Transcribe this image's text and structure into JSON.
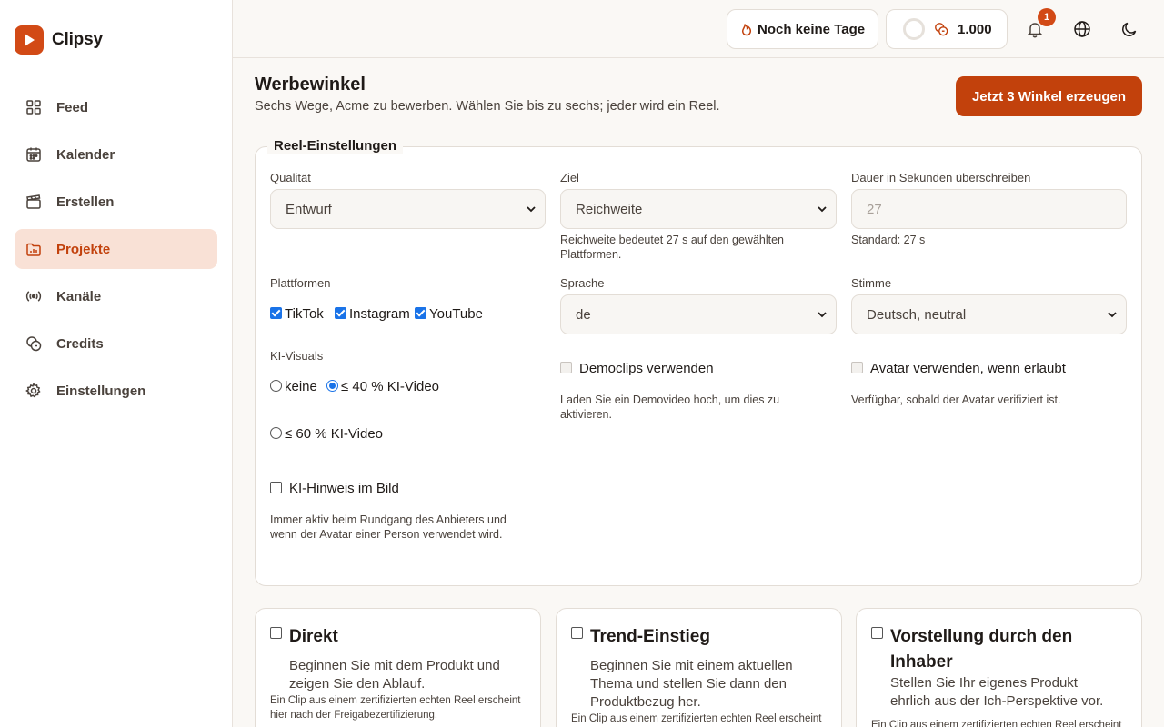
{
  "app": {
    "name": "Clipsy"
  },
  "colors": {
    "accent": "#c2410c",
    "brand": "#d24a16",
    "active_bg": "#f9e1d6",
    "checkbox": "#1a73e8"
  },
  "sidebar": {
    "items": [
      {
        "label": "Feed",
        "icon": "grid-icon"
      },
      {
        "label": "Kalender",
        "icon": "calendar-icon"
      },
      {
        "label": "Erstellen",
        "icon": "clapperboard-icon"
      },
      {
        "label": "Projekte",
        "icon": "folder-chart-icon",
        "active": true
      },
      {
        "label": "Kanäle",
        "icon": "broadcast-icon"
      },
      {
        "label": "Credits",
        "icon": "coins-icon"
      },
      {
        "label": "Einstellungen",
        "icon": "gear-icon"
      }
    ]
  },
  "topbar": {
    "streak_label": "Noch keine Tage",
    "credits_value": "1.000",
    "notifications_count": "1"
  },
  "page": {
    "title": "Werbewinkel",
    "subtitle": "Sechs Wege, Acme zu bewerben. Wählen Sie bis zu sechs; jeder wird ein Reel.",
    "generate_button": "Jetzt 3 Winkel erzeugen"
  },
  "settings": {
    "legend": "Reel-Einstellungen",
    "quality": {
      "label": "Qualität",
      "value": "Entwurf"
    },
    "goal": {
      "label": "Ziel",
      "value": "Reichweite",
      "hint": "Reichweite bedeutet 27 s auf den gewählten Plattformen."
    },
    "duration": {
      "label": "Dauer in Sekunden überschreiben",
      "placeholder": "27",
      "hint": "Standard: 27 s"
    },
    "platforms": {
      "label": "Plattformen",
      "options": [
        {
          "label": "TikTok",
          "checked": true
        },
        {
          "label": "Instagram",
          "checked": true
        },
        {
          "label": "YouTube",
          "checked": true
        }
      ]
    },
    "language": {
      "label": "Sprache",
      "value": "de"
    },
    "voice": {
      "label": "Stimme",
      "value": "Deutsch, neutral"
    },
    "ai_visuals": {
      "label": "KI-Visuals",
      "options": [
        {
          "label": "keine",
          "selected": false
        },
        {
          "label": "≤ 40 % KI-Video",
          "selected": true
        },
        {
          "label": "≤ 60 % KI-Video",
          "selected": false
        }
      ]
    },
    "demo_clips": {
      "label": "Democlips verwenden",
      "hint": "Laden Sie ein Demovideo hoch, um dies zu aktivieren."
    },
    "avatar": {
      "label": "Avatar verwenden, wenn erlaubt",
      "hint": "Verfügbar, sobald der Avatar verifiziert ist."
    },
    "ai_notice": {
      "label": "KI-Hinweis im Bild",
      "hint": "Immer aktiv beim Rundgang des Anbieters und wenn der Avatar einer Person verwendet wird."
    }
  },
  "angles": [
    {
      "title": "Direkt",
      "description": "Beginnen Sie mit dem Produkt und zeigen Sie den Ablauf.",
      "note": "Ein Clip aus einem zertifizierten echten Reel erscheint hier nach der Freigabezertifizierung."
    },
    {
      "title": "Trend-Einstieg",
      "description": "Beginnen Sie mit einem aktuellen Thema und stellen Sie dann den Produktbezug her.",
      "note": "Ein Clip aus einem zertifizierten echten Reel erscheint hier nach der Freigabezertifizierung."
    },
    {
      "title": "Vorstellung durch den Inhaber",
      "description": "Stellen Sie Ihr eigenes Produkt ehrlich aus der Ich-Perspektive vor.",
      "note": "Ein Clip aus einem zertifizierten echten Reel erscheint hier nach der Freigabezertifizierung."
    }
  ]
}
